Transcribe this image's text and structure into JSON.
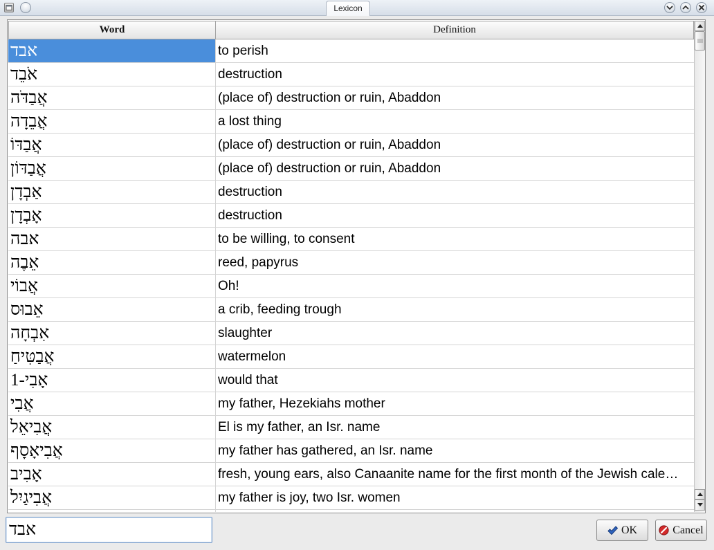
{
  "window": {
    "title": "Lexicon",
    "controls": {
      "menu": "window-menu-icon",
      "all_desktops": "circle-icon",
      "minimize": "chevron-down-icon",
      "maximize": "chevron-up-icon",
      "close": "close-icon"
    }
  },
  "table": {
    "columns": {
      "word": "Word",
      "definition": "Definition"
    },
    "rows": [
      {
        "word": "אבד",
        "definition": "to perish",
        "selected": true
      },
      {
        "word": "אֹבֵד",
        "definition": "destruction"
      },
      {
        "word": "אֲבַדֹּה",
        "definition": "(place of) destruction or ruin, Abaddon"
      },
      {
        "word": "אֲבֵדָה",
        "definition": "a lost thing"
      },
      {
        "word": "אֲבַדּוֹ",
        "definition": "(place of) destruction or ruin, Abaddon"
      },
      {
        "word": "אֲבַדּוֹן",
        "definition": "(place of) destruction or ruin, Abaddon"
      },
      {
        "word": "אַבְדָן",
        "definition": "destruction"
      },
      {
        "word": "אָבְדָן",
        "definition": "destruction"
      },
      {
        "word": "אבה",
        "definition": "to be willing, to consent"
      },
      {
        "word": "אֵבֶה",
        "definition": "reed, papyrus"
      },
      {
        "word": "אֲבוֹי",
        "definition": "Oh!"
      },
      {
        "word": "אֵבוּס",
        "definition": "a crib, feeding trough"
      },
      {
        "word": "אִבְחָה",
        "definition": "slaughter"
      },
      {
        "word": "אֲבַטִּיחַ",
        "definition": "watermelon"
      },
      {
        "word": "אָבִי-1",
        "definition": "would that"
      },
      {
        "word": "אֲבִי",
        "definition": "my father, Hezekiahs mother"
      },
      {
        "word": "אֲבִיאֵל",
        "definition": "El is my father, an Isr. name"
      },
      {
        "word": "אֲבִיאָסָף",
        "definition": "my father has gathered, an Isr. name"
      },
      {
        "word": "אָבִיב",
        "definition": "fresh, young ears, also Canaanite name for the first month of the Jewish cale…"
      },
      {
        "word": "אֲבִיגַיִל",
        "definition": "my father is joy, two Isr. women"
      }
    ]
  },
  "scrollbar": {
    "icons": {
      "top": "arrow-up-icon",
      "bottom_up": "arrow-up-icon",
      "bottom_down": "arrow-down-icon"
    }
  },
  "search": {
    "value": "אבד"
  },
  "buttons": {
    "ok": {
      "label": "OK",
      "icon": "checkmark-icon"
    },
    "cancel": {
      "label": "Cancel",
      "icon": "cancel-icon"
    }
  },
  "colors": {
    "selection": "#4a8edb",
    "selection_text": "#ffffff",
    "ok_icon": "#2f64bf",
    "cancel_icon": "#d42a2a"
  }
}
